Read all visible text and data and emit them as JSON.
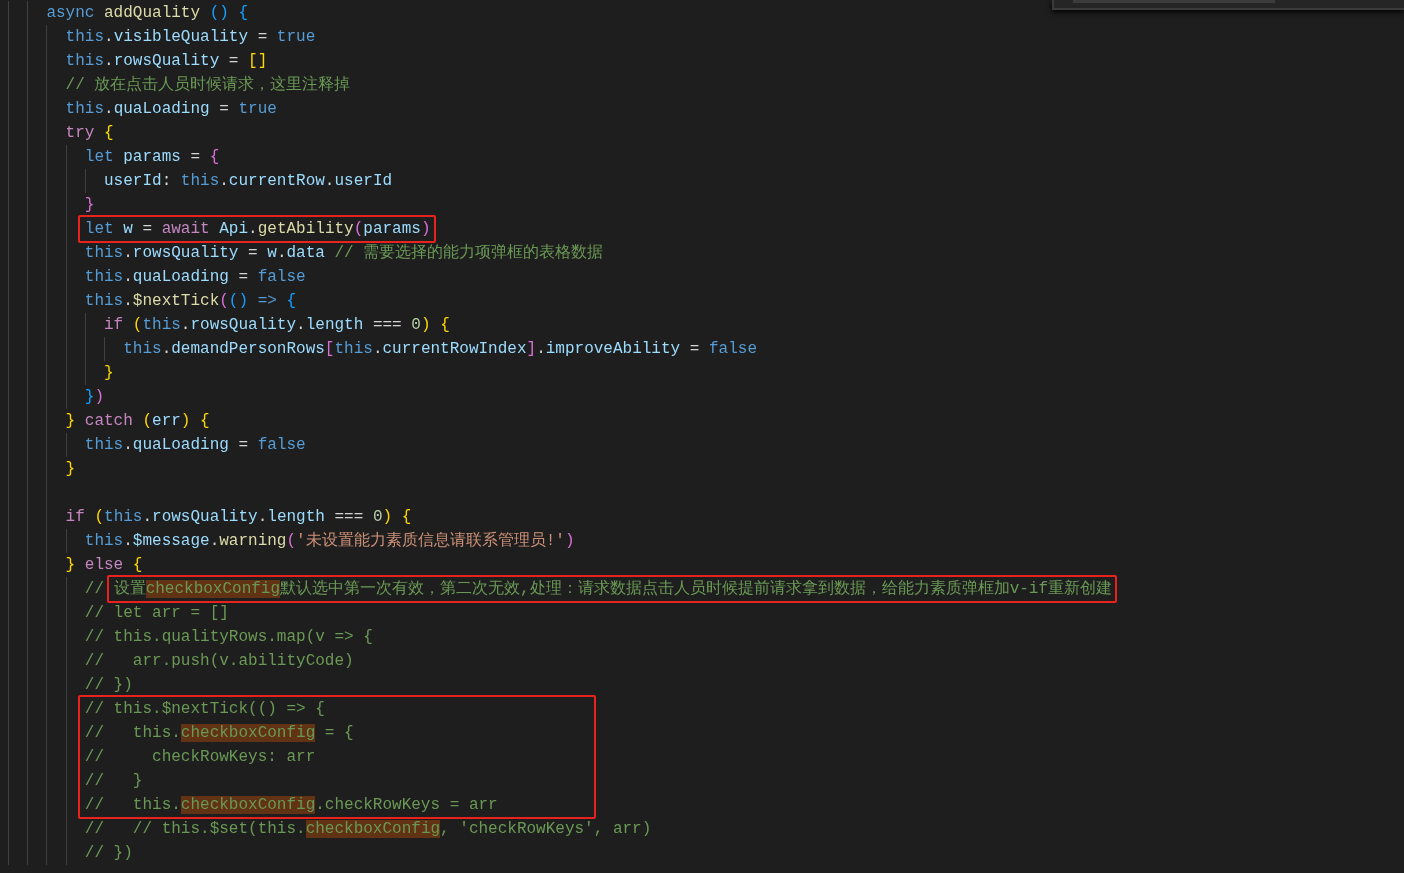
{
  "editor": {
    "lines": [
      {
        "tokens": [
          {
            "text": "async ",
            "kind": "kw"
          },
          {
            "text": "addQuality ",
            "kind": "fn"
          },
          {
            "text": "() {",
            "kind": "b3"
          }
        ],
        "sections": [
          [
            {
              "tokens": [
                {
                  "text": "this",
                  "kind": "kw"
                },
                {
                  "text": ".",
                  "kind": "plain"
                },
                {
                  "text": "visibleQuality",
                  "kind": "var"
                },
                {
                  "text": " = ",
                  "kind": "plain"
                },
                {
                  "text": "true",
                  "kind": "kw"
                }
              ]
            },
            {
              "tokens": [
                {
                  "text": "this",
                  "kind": "kw"
                },
                {
                  "text": ".",
                  "kind": "plain"
                },
                {
                  "text": "rowsQuality",
                  "kind": "var"
                },
                {
                  "text": " = ",
                  "kind": "plain"
                },
                {
                  "text": "[]",
                  "kind": "b1"
                }
              ]
            },
            {
              "tokens": [
                {
                  "text": "// 放在点击人员时候请求，这里注释掉",
                  "kind": "cm"
                }
              ]
            },
            {
              "tokens": [
                {
                  "text": "this",
                  "kind": "kw"
                },
                {
                  "text": ".",
                  "kind": "plain"
                },
                {
                  "text": "quaLoading",
                  "kind": "var"
                },
                {
                  "text": " = ",
                  "kind": "plain"
                },
                {
                  "text": "true",
                  "kind": "kw"
                }
              ]
            },
            {
              "tokens": [
                {
                  "text": "try ",
                  "kind": "ctl"
                },
                {
                  "text": "{",
                  "kind": "b1"
                }
              ],
              "children": [
                {
                  "tokens": [
                    {
                      "text": "let ",
                      "kind": "kw"
                    },
                    {
                      "text": "params",
                      "kind": "var"
                    },
                    {
                      "text": " = ",
                      "kind": "plain"
                    },
                    {
                      "text": "{",
                      "kind": "b2"
                    }
                  ],
                  "children": [
                    {
                      "tokens": [
                        {
                          "text": "userId",
                          "kind": "var"
                        },
                        {
                          "text": ": ",
                          "kind": "plain"
                        },
                        {
                          "text": "this",
                          "kind": "kw"
                        },
                        {
                          "text": ".",
                          "kind": "plain"
                        },
                        {
                          "text": "currentRow",
                          "kind": "var"
                        },
                        {
                          "text": ".",
                          "kind": "plain"
                        },
                        {
                          "text": "userId",
                          "kind": "var"
                        }
                      ]
                    }
                  ]
                },
                {
                  "tokens": [
                    {
                      "text": "}",
                      "kind": "b2"
                    }
                  ]
                },
                {
                  "tokens": [
                    {
                      "kind": "box",
                      "tokens": [
                        {
                          "text": "let ",
                          "kind": "kw"
                        },
                        {
                          "text": "w",
                          "kind": "var"
                        },
                        {
                          "text": " = ",
                          "kind": "plain"
                        },
                        {
                          "text": "await ",
                          "kind": "ctl"
                        },
                        {
                          "text": "Api",
                          "kind": "var"
                        },
                        {
                          "text": ".",
                          "kind": "plain"
                        },
                        {
                          "text": "getAbility",
                          "kind": "fn"
                        },
                        {
                          "text": "(",
                          "kind": "b2"
                        },
                        {
                          "text": "params",
                          "kind": "var"
                        },
                        {
                          "text": ")",
                          "kind": "b2"
                        }
                      ]
                    }
                  ]
                },
                {
                  "tokens": [
                    {
                      "text": "this",
                      "kind": "kw"
                    },
                    {
                      "text": ".",
                      "kind": "plain"
                    },
                    {
                      "text": "rowsQuality",
                      "kind": "var"
                    },
                    {
                      "text": " = ",
                      "kind": "plain"
                    },
                    {
                      "text": "w",
                      "kind": "var"
                    },
                    {
                      "text": ".",
                      "kind": "plain"
                    },
                    {
                      "text": "data ",
                      "kind": "var"
                    },
                    {
                      "text": "// 需要选择的能力项弹框的表格数据",
                      "kind": "cm"
                    }
                  ]
                },
                {
                  "tokens": [
                    {
                      "text": "this",
                      "kind": "kw"
                    },
                    {
                      "text": ".",
                      "kind": "plain"
                    },
                    {
                      "text": "quaLoading",
                      "kind": "var"
                    },
                    {
                      "text": " = ",
                      "kind": "plain"
                    },
                    {
                      "text": "false",
                      "kind": "kw"
                    }
                  ]
                },
                {
                  "tokens": [
                    {
                      "text": "this",
                      "kind": "kw"
                    },
                    {
                      "text": ".",
                      "kind": "plain"
                    },
                    {
                      "text": "$nextTick",
                      "kind": "fn"
                    },
                    {
                      "text": "(",
                      "kind": "b2"
                    },
                    {
                      "text": "() ",
                      "kind": "b3"
                    },
                    {
                      "text": "=> ",
                      "kind": "kw"
                    },
                    {
                      "text": "{",
                      "kind": "b3"
                    }
                  ],
                  "children": [
                    {
                      "tokens": [
                        {
                          "text": "if ",
                          "kind": "ctl"
                        },
                        {
                          "text": "(",
                          "kind": "b1"
                        },
                        {
                          "text": "this",
                          "kind": "kw"
                        },
                        {
                          "text": ".",
                          "kind": "plain"
                        },
                        {
                          "text": "rowsQuality",
                          "kind": "var"
                        },
                        {
                          "text": ".",
                          "kind": "plain"
                        },
                        {
                          "text": "length",
                          "kind": "var"
                        },
                        {
                          "text": " === ",
                          "kind": "plain"
                        },
                        {
                          "text": "0",
                          "kind": "num"
                        },
                        {
                          "text": ") {",
                          "kind": "b1"
                        }
                      ],
                      "children": [
                        {
                          "tokens": [
                            {
                              "text": "this",
                              "kind": "kw"
                            },
                            {
                              "text": ".",
                              "kind": "plain"
                            },
                            {
                              "text": "demandPersonRows",
                              "kind": "var"
                            },
                            {
                              "text": "[",
                              "kind": "b2"
                            },
                            {
                              "text": "this",
                              "kind": "kw"
                            },
                            {
                              "text": ".",
                              "kind": "plain"
                            },
                            {
                              "text": "currentRowIndex",
                              "kind": "var"
                            },
                            {
                              "text": "]",
                              "kind": "b2"
                            },
                            {
                              "text": ".",
                              "kind": "plain"
                            },
                            {
                              "text": "improveAbility",
                              "kind": "var"
                            },
                            {
                              "text": " = ",
                              "kind": "plain"
                            },
                            {
                              "text": "false",
                              "kind": "kw"
                            }
                          ]
                        }
                      ]
                    },
                    {
                      "tokens": [
                        {
                          "text": "}",
                          "kind": "b1"
                        }
                      ]
                    }
                  ]
                },
                {
                  "tokens": [
                    {
                      "text": "}",
                      "kind": "b3"
                    },
                    {
                      "text": ")",
                      "kind": "b2"
                    }
                  ]
                }
              ]
            },
            {
              "tokens": [
                {
                  "text": "} ",
                  "kind": "b1"
                },
                {
                  "text": "catch ",
                  "kind": "ctl"
                },
                {
                  "text": "(",
                  "kind": "b1"
                },
                {
                  "text": "err",
                  "kind": "var"
                },
                {
                  "text": ") {",
                  "kind": "b1"
                }
              ],
              "children": [
                {
                  "tokens": [
                    {
                      "text": "this",
                      "kind": "kw"
                    },
                    {
                      "text": ".",
                      "kind": "plain"
                    },
                    {
                      "text": "quaLoading",
                      "kind": "var"
                    },
                    {
                      "text": " = ",
                      "kind": "plain"
                    },
                    {
                      "text": "false",
                      "kind": "kw"
                    }
                  ]
                }
              ]
            },
            {
              "tokens": [
                {
                  "text": "}",
                  "kind": "b1"
                }
              ]
            }
          ],
          [
            {
              "tokens": [
                {
                  "text": "if ",
                  "kind": "ctl"
                },
                {
                  "text": "(",
                  "kind": "b1"
                },
                {
                  "text": "this",
                  "kind": "kw"
                },
                {
                  "text": ".",
                  "kind": "plain"
                },
                {
                  "text": "rowsQuality",
                  "kind": "var"
                },
                {
                  "text": ".",
                  "kind": "plain"
                },
                {
                  "text": "length",
                  "kind": "var"
                },
                {
                  "text": " === ",
                  "kind": "plain"
                },
                {
                  "text": "0",
                  "kind": "num"
                },
                {
                  "text": ") {",
                  "kind": "b1"
                }
              ],
              "children": [
                {
                  "tokens": [
                    {
                      "text": "this",
                      "kind": "kw"
                    },
                    {
                      "text": ".",
                      "kind": "plain"
                    },
                    {
                      "text": "$message",
                      "kind": "var"
                    },
                    {
                      "text": ".",
                      "kind": "plain"
                    },
                    {
                      "text": "warning",
                      "kind": "fn"
                    },
                    {
                      "text": "(",
                      "kind": "b2"
                    },
                    {
                      "text": "'未设置能力素质信息请联系管理员!'",
                      "kind": "str"
                    },
                    {
                      "text": ")",
                      "kind": "b2"
                    }
                  ]
                }
              ]
            },
            {
              "tokens": [
                {
                  "text": "} ",
                  "kind": "b1"
                },
                {
                  "text": "else ",
                  "kind": "ctl"
                },
                {
                  "text": "{",
                  "kind": "b1"
                }
              ],
              "children": [
                {
                  "tokens": [
                    {
                      "text": "// ",
                      "kind": "cm"
                    },
                    {
                      "kind": "box",
                      "tokens": [
                        {
                          "text": "设置",
                          "kind": "cm"
                        },
                        {
                          "text": "checkboxConfig",
                          "kind": "hl"
                        },
                        {
                          "text": "默认选中第一次有效，第二次无效,处理：请求数据点击人员时候提前请求拿到数据，给能力素质弹框加v-if重新创建",
                          "kind": "cm"
                        }
                      ]
                    }
                  ]
                },
                {
                  "tokens": [
                    {
                      "text": "// let arr = []",
                      "kind": "cm"
                    }
                  ]
                },
                {
                  "tokens": [
                    {
                      "text": "// this.qualityRows.map(v => {",
                      "kind": "cm"
                    }
                  ]
                },
                {
                  "tokens": [
                    {
                      "text": "//   arr.push(v.abilityCode)",
                      "kind": "cm"
                    }
                  ]
                },
                {
                  "tokens": [
                    {
                      "text": "// })",
                      "kind": "cm"
                    }
                  ]
                },
                {
                  "kind": "box",
                  "lines": [
                    [
                      {
                        "text": "// this.$nextTick(() => {",
                        "kind": "cm"
                      }
                    ],
                    [
                      {
                        "text": "//   this.",
                        "kind": "cm"
                      },
                      {
                        "text": "checkboxConfig",
                        "kind": "hl"
                      },
                      {
                        "text": " = {",
                        "kind": "cm"
                      }
                    ],
                    [
                      {
                        "text": "//     checkRowKeys: arr",
                        "kind": "cm"
                      }
                    ],
                    [
                      {
                        "text": "//   }",
                        "kind": "cm"
                      }
                    ],
                    [
                      {
                        "text": "//   this.",
                        "kind": "cm"
                      },
                      {
                        "text": "checkboxConfig",
                        "kind": "hl"
                      },
                      {
                        "text": ".checkRowKeys = arr",
                        "kind": "cm"
                      }
                    ]
                  ]
                },
                {
                  "tokens": [
                    {
                      "text": "//   // this.$set(this.",
                      "kind": "cm"
                    },
                    {
                      "text": "checkboxConfig",
                      "kind": "hl"
                    },
                    {
                      "text": ", 'checkRowKeys', arr)",
                      "kind": "cm"
                    }
                  ]
                },
                {
                  "tokens": [
                    {
                      "text": "// })",
                      "kind": "cm"
                    }
                  ]
                }
              ]
            }
          ]
        ]
      }
    ]
  }
}
